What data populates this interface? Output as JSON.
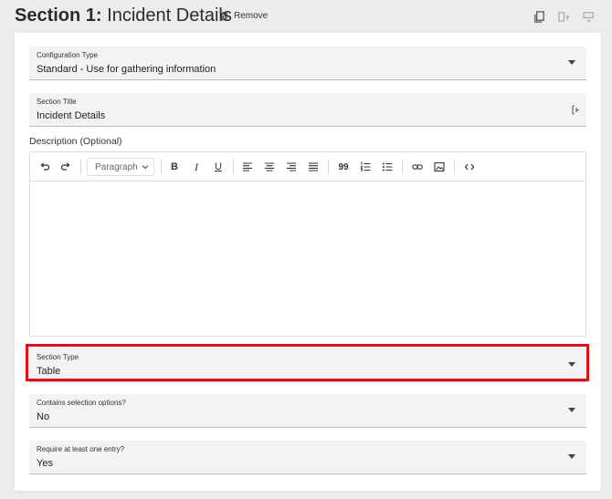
{
  "header": {
    "section_prefix": "Section 1:",
    "section_name": "Incident Details",
    "remove_label": "Remove"
  },
  "fields": {
    "config_type": {
      "label": "Configuration Type",
      "value": "Standard - Use for gathering information"
    },
    "section_title": {
      "label": "Section Title",
      "value": "Incident Details"
    },
    "section_type": {
      "label": "Section Type",
      "value": "Table"
    },
    "selection_options": {
      "label": "Contains selection options?",
      "value": "No"
    },
    "require_entry": {
      "label": "Require at least one entry?",
      "value": "Yes"
    }
  },
  "description": {
    "label": "Description (Optional)",
    "block_format": "Paragraph"
  },
  "toolbar_icons": [
    "undo-icon",
    "redo-icon",
    "bold-icon",
    "italic-icon",
    "underline-icon",
    "align-left-icon",
    "align-center-icon",
    "align-right-icon",
    "align-justify-icon",
    "blockquote-icon",
    "numbered-list-icon",
    "bullet-list-icon",
    "link-icon",
    "image-icon",
    "code-icon"
  ],
  "colors": {
    "highlight": "#e01019",
    "field_bg": "#f3f3f4",
    "page_bg": "#ececed"
  }
}
